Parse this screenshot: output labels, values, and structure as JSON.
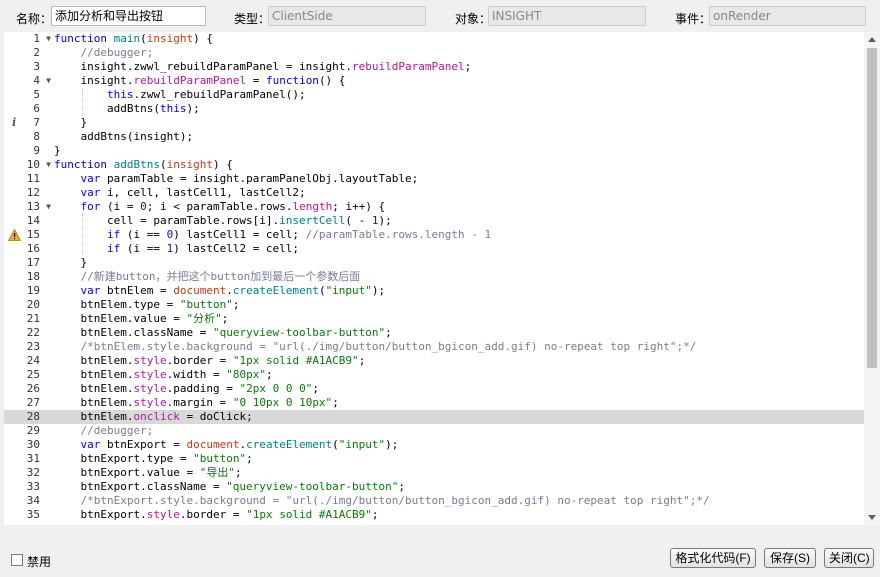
{
  "header": {
    "name_label": "名称：",
    "name_value": "添加分析和导出按钮",
    "type_label": "类型：",
    "type_value": "ClientSide",
    "object_label": "对象：",
    "object_value": "INSIGHT",
    "event_label": "事件：",
    "event_value": "onRender"
  },
  "editor": {
    "active_line": 28,
    "info_marker_line": 7,
    "warning_marker_line": 15,
    "fold_lines": [
      1,
      4,
      10,
      13
    ],
    "lines": [
      {
        "n": 1,
        "text": "function main(insight) {"
      },
      {
        "n": 2,
        "text": "    //debugger;"
      },
      {
        "n": 3,
        "text": "    insight.zwwl_rebuildParamPanel = insight.rebuildParamPanel;"
      },
      {
        "n": 4,
        "text": "    insight.rebuildParamPanel = function() {"
      },
      {
        "n": 5,
        "text": "        this.zwwl_rebuildParamPanel();"
      },
      {
        "n": 6,
        "text": "        addBtns(this);"
      },
      {
        "n": 7,
        "text": "    }"
      },
      {
        "n": 8,
        "text": "    addBtns(insight);"
      },
      {
        "n": 9,
        "text": "}"
      },
      {
        "n": 10,
        "text": "function addBtns(insight) {"
      },
      {
        "n": 11,
        "text": "    var paramTable = insight.paramPanelObj.layoutTable;"
      },
      {
        "n": 12,
        "text": "    var i, cell, lastCell1, lastCell2;"
      },
      {
        "n": 13,
        "text": "    for (i = 0; i < paramTable.rows.length; i++) {"
      },
      {
        "n": 14,
        "text": "        cell = paramTable.rows[i].insertCell( - 1);"
      },
      {
        "n": 15,
        "text": "        if (i == 0) lastCell1 = cell; //paramTable.rows.length - 1"
      },
      {
        "n": 16,
        "text": "        if (i == 1) lastCell2 = cell;"
      },
      {
        "n": 17,
        "text": "    }"
      },
      {
        "n": 18,
        "text": "    //新建button，并把这个button加到最后一个参数后面"
      },
      {
        "n": 19,
        "text": "    var btnElem = document.createElement(\"input\");"
      },
      {
        "n": 20,
        "text": "    btnElem.type = \"button\";"
      },
      {
        "n": 21,
        "text": "    btnElem.value = \"分析\";"
      },
      {
        "n": 22,
        "text": "    btnElem.className = \"queryview-toolbar-button\";"
      },
      {
        "n": 23,
        "text": "    /*btnElem.style.background = \"url(./img/button/button_bgicon_add.gif) no-repeat top right\";*/"
      },
      {
        "n": 24,
        "text": "    btnElem.style.border = \"1px solid #A1ACB9\";"
      },
      {
        "n": 25,
        "text": "    btnElem.style.width = \"80px\";"
      },
      {
        "n": 26,
        "text": "    btnElem.style.padding = \"2px 0 0 0\";"
      },
      {
        "n": 27,
        "text": "    btnElem.style.margin = \"0 10px 0 10px\";"
      },
      {
        "n": 28,
        "text": "    btnElem.onclick = doClick;"
      },
      {
        "n": 29,
        "text": "    //debugger;"
      },
      {
        "n": 30,
        "text": "    var btnExport = document.createElement(\"input\");"
      },
      {
        "n": 31,
        "text": "    btnExport.type = \"button\";"
      },
      {
        "n": 32,
        "text": "    btnExport.value = \"导出\";"
      },
      {
        "n": 33,
        "text": "    btnExport.className = \"queryview-toolbar-button\";"
      },
      {
        "n": 34,
        "text": "    /*btnExport.style.background = \"url(./img/button/button_bgicon_add.gif) no-repeat top right\";*/"
      },
      {
        "n": 35,
        "text": "    btnExport.style.border = \"1px solid #A1ACB9\";"
      }
    ]
  },
  "footer": {
    "disable_label": "禁用",
    "format_button": "格式化代码(F)",
    "save_button": "保存(S)",
    "close_button": "关闭(C)"
  }
}
